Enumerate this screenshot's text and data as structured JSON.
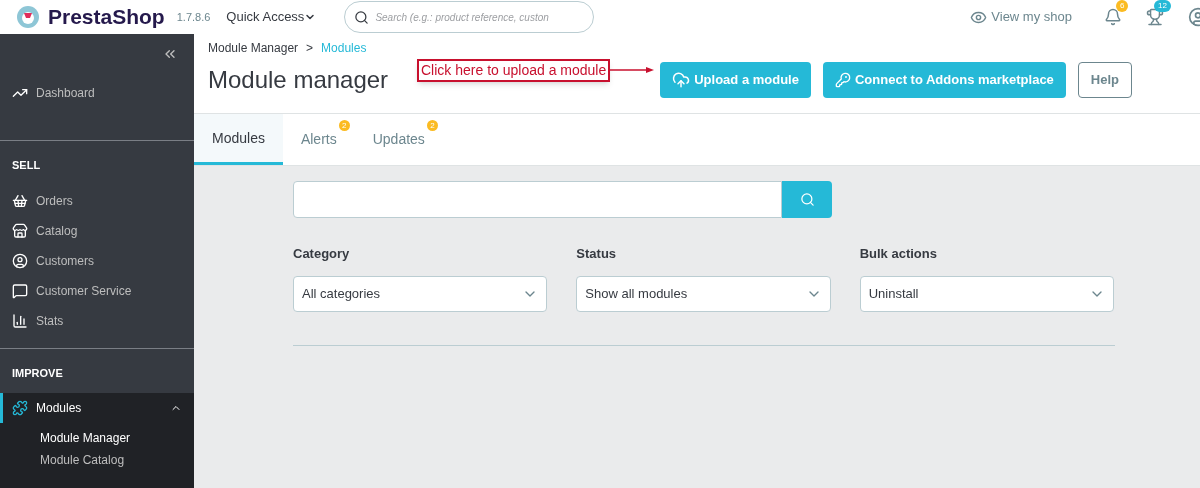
{
  "header": {
    "logo": "PrestaShop",
    "version": "1.7.8.6",
    "quick_access": "Quick Access",
    "search": {
      "placeholder": "Search (e.g.: product reference, custon"
    },
    "view_shop": "View my shop",
    "notifications": "6",
    "trophies": "12"
  },
  "sidebar": {
    "sections": [
      {
        "items": [
          {
            "label": "Dashboard",
            "selected": false
          }
        ]
      },
      {
        "title": "SELL",
        "items": [
          {
            "label": "Orders",
            "selected": false
          },
          {
            "label": "Catalog",
            "selected": false
          },
          {
            "label": "Customers",
            "selected": false
          },
          {
            "label": "Customer Service",
            "selected": false
          },
          {
            "label": "Stats",
            "selected": false
          }
        ]
      },
      {
        "title": "IMPROVE",
        "items": [
          {
            "label": "Modules",
            "selected": true,
            "expanded": true,
            "children": [
              {
                "label": "Module Manager",
                "selected": true
              },
              {
                "label": "Module Catalog",
                "selected": false
              }
            ]
          }
        ]
      }
    ]
  },
  "breadcrumb": {
    "separator": ">",
    "items": [
      "Module Manager",
      "Modules"
    ]
  },
  "page_title": "Module manager",
  "annotation": "Click here to upload a module",
  "toolbar": [
    {
      "label": "Upload a module",
      "kind": "upload"
    },
    {
      "label": "Connect to Addons marketplace",
      "kind": "key"
    },
    {
      "label": "Help",
      "kind": "plain"
    }
  ],
  "tabs": [
    {
      "label": "Modules",
      "selected": true
    },
    {
      "label": "Alerts",
      "selected": false,
      "badge": "2"
    },
    {
      "label": "Updates",
      "selected": false,
      "badge": "2"
    }
  ],
  "filters": [
    {
      "label": "Category",
      "value": "All categories"
    },
    {
      "label": "Status",
      "value": "Show all modules"
    },
    {
      "label": "Bulk actions",
      "value": "Uninstall"
    }
  ]
}
